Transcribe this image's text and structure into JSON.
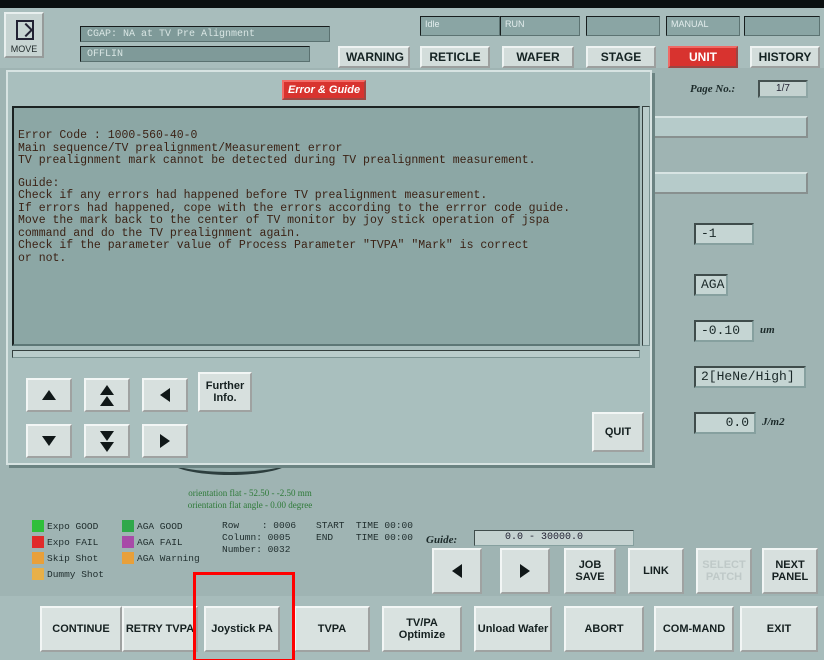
{
  "topbar": {
    "move_label": "MOVE",
    "status_line_1": "CGAP: NA at TV Pre Alignment",
    "status_line_2": "OFFLIN",
    "mode_cells": [
      "Idle",
      "RUN",
      "",
      "MANUAL",
      ""
    ],
    "buttons": {
      "warning": "WARNING",
      "reticle": "RETICLE",
      "wafer": "WAFER",
      "stage": "STAGE",
      "unit": "UNIT",
      "history": "HISTORY"
    }
  },
  "right_panel": {
    "page_label": "Page No.:",
    "page_value": "1/7",
    "values": {
      "v1": "-1",
      "v2": "AGA",
      "v3": "-0.10",
      "v3_unit": "um",
      "v4": "2[HeNe/High]",
      "v5": "0.0",
      "v5_unit": "J/m2"
    }
  },
  "dialog": {
    "title": "Error & Guide",
    "error_lines": [
      "Error Code : 1000-560-40-0",
      "Main sequence/TV prealignment/Measurement error",
      "TV prealignment mark cannot be detected during TV prealignment measurement."
    ],
    "guide_lines": [
      "Guide:",
      "Check if any errors had happened before TV prealignment measurement.",
      "If errors had happened, cope with the errors according to the errror code guide.",
      "Move the mark back to the center of TV monitor by joy stick operation of jspa",
      "command and do the TV prealignment again.",
      "Check if the parameter value of Process Parameter \"TVPA\" \"Mark\" is correct",
      "or not."
    ],
    "further_info": "Further Info.",
    "quit": "QUIT"
  },
  "lower_info": {
    "orientation_1": "orientation flat - 52.50 - -2.50 mm",
    "orientation_2": "orientation flat angle - 0.00 degree",
    "legend": [
      {
        "label": "Expo GOOD",
        "color": "#2fbf3a"
      },
      {
        "label": "AGA GOOD",
        "color": "#2fa84a"
      },
      {
        "label": "Expo FAIL",
        "color": "#e02a2a"
      },
      {
        "label": "AGA FAIL",
        "color": "#a84aa8"
      },
      {
        "label": "Skip Shot",
        "color": "#e8a03a"
      },
      {
        "label": "AGA Warning",
        "color": "#e8a03a"
      },
      {
        "label": "Dummy Shot",
        "color": "#e8b048"
      }
    ],
    "row": "Row    : 0006",
    "column": "Column: 0005",
    "number": "Number: 0032",
    "start_time": "START  TIME 00:00",
    "end_time": "END    TIME 00:00"
  },
  "guide_range": {
    "label": "Guide:",
    "value": "0.0  -  30000.0"
  },
  "side_buttons": {
    "job_save": "JOB SAVE",
    "link": "LINK",
    "select_patch": "SELECT PATCH",
    "next_panel": "NEXT PANEL"
  },
  "function_bar": {
    "continue": "CONTINUE",
    "retry_tvpa": "RETRY TVPA",
    "joystick_pa": "Joystick PA",
    "tvpa": "TVPA",
    "tvpa_optimize": "TV/PA Optimize",
    "unload_wafer": "Unload Wafer",
    "abort": "ABORT",
    "command": "COM-MAND",
    "exit": "EXIT"
  }
}
